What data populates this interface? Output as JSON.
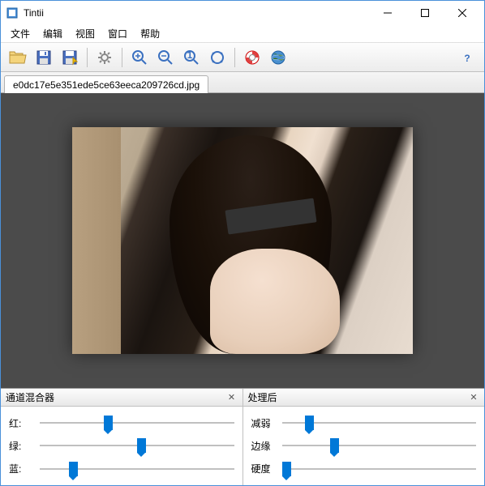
{
  "window": {
    "title": "Tintii"
  },
  "menu": {
    "file": "文件",
    "edit": "编辑",
    "view": "视图",
    "window": "窗口",
    "help": "帮助"
  },
  "tabs": [
    {
      "filename": "e0dc17e5e351ede5ce63eeca209726cd.jpg"
    }
  ],
  "panel_left": {
    "title": "通道混合器",
    "sliders": [
      {
        "label": "红:",
        "pos": 33
      },
      {
        "label": "绿:",
        "pos": 50
      },
      {
        "label": "蓝:",
        "pos": 15
      }
    ]
  },
  "panel_right": {
    "title": "处理后",
    "sliders": [
      {
        "label": "减弱",
        "pos": 12
      },
      {
        "label": "边缘",
        "pos": 25
      },
      {
        "label": "硬度",
        "pos": 0
      }
    ]
  }
}
